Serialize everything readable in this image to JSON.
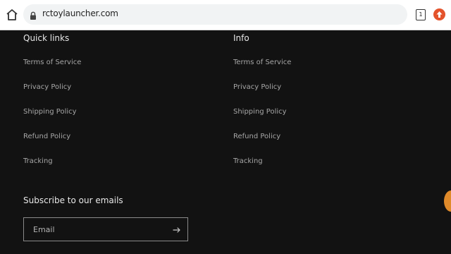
{
  "browser": {
    "url": "rctoylauncher.com",
    "tab_count": "1"
  },
  "footer": {
    "quick_links": {
      "title": "Quick links",
      "items": [
        "Terms of Service",
        "Privacy Policy",
        "Shipping Policy",
        "Refund Policy",
        "Tracking"
      ]
    },
    "info": {
      "title": "Info",
      "items": [
        "Terms of Service",
        "Privacy Policy",
        "Shipping Policy",
        "Refund Policy",
        "Tracking"
      ]
    },
    "subscribe": {
      "title": "Subscribe to our emails",
      "email_placeholder": "Email"
    }
  },
  "colors": {
    "background": "#121212",
    "heading": "#e8e8e8",
    "link": "#a6a6a6",
    "extension_icon": "#e4532c",
    "chat_bubble": "#e08a2a"
  }
}
